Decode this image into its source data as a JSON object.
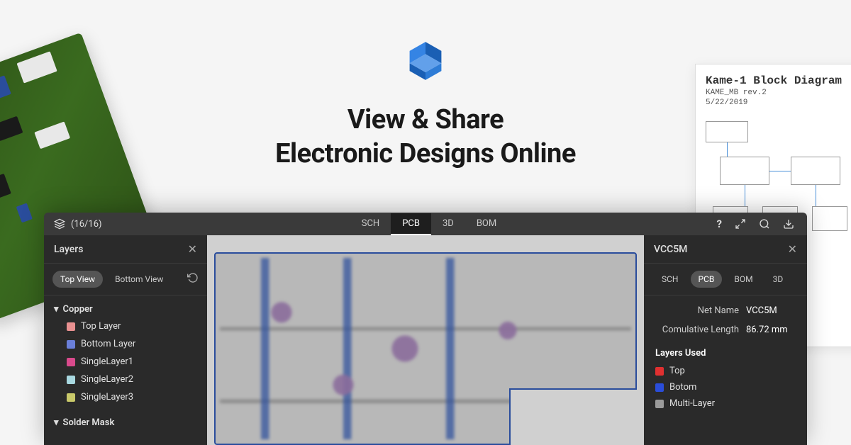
{
  "hero": {
    "title_line1": "View & Share",
    "title_line2": "Electronic Designs Online"
  },
  "schematic_preview": {
    "title": "Kame-1 Block Diagram",
    "subtitle": "KAME_MB rev.2",
    "date": "5/22/2019"
  },
  "topbar": {
    "layer_ratio": "(16/16)",
    "tabs": [
      {
        "label": "SCH",
        "active": false
      },
      {
        "label": "PCB",
        "active": true
      },
      {
        "label": "3D",
        "active": false
      },
      {
        "label": "BOM",
        "active": false
      }
    ]
  },
  "layers_panel": {
    "title": "Layers",
    "view_options": [
      {
        "label": "Top View",
        "active": true
      },
      {
        "label": "Bottom View",
        "active": false
      }
    ],
    "groups": [
      {
        "name": "Copper",
        "expanded": true,
        "items": [
          {
            "label": "Top Layer",
            "color": "#e89090"
          },
          {
            "label": "Bottom Layer",
            "color": "#6a7fd9"
          },
          {
            "label": "SingleLayer1",
            "color": "#d94a8c"
          },
          {
            "label": "SingleLayer2",
            "color": "#a8d8e0"
          },
          {
            "label": "SingleLayer3",
            "color": "#c9c96a"
          }
        ]
      },
      {
        "name": "Solder Mask",
        "expanded": true,
        "items": []
      }
    ]
  },
  "detail_panel": {
    "title": "VCC5M",
    "tabs": [
      {
        "label": "SCH",
        "active": false
      },
      {
        "label": "PCB",
        "active": true
      },
      {
        "label": "BOM",
        "active": false
      },
      {
        "label": "3D",
        "active": false
      }
    ],
    "properties": [
      {
        "label": "Net Name",
        "value": "VCC5M"
      },
      {
        "label": "Comulative Length",
        "value": "86.72 mm"
      }
    ],
    "layers_used_title": "Layers Used",
    "layers_used": [
      {
        "label": "Top",
        "color": "#e03030"
      },
      {
        "label": "Botom",
        "color": "#2a4dd9"
      },
      {
        "label": "Multi-Layer",
        "color": "#9a9a9a"
      }
    ]
  }
}
